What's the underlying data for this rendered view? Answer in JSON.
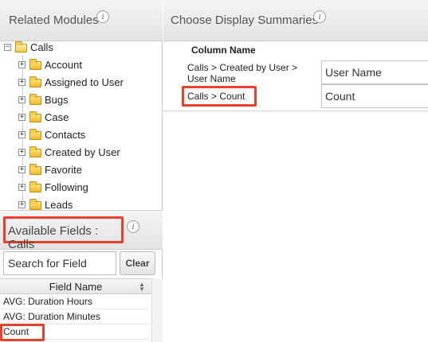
{
  "related_modules": {
    "title": "Related Modules",
    "info": "i",
    "root": "Calls",
    "items": [
      "Account",
      "Assigned to User",
      "Bugs",
      "Case",
      "Contacts",
      "Created by User",
      "Favorite",
      "Following",
      "Leads"
    ]
  },
  "available_fields": {
    "title": "Available Fields : Calls",
    "info": "i",
    "search_placeholder": "Search for Field",
    "clear_label": "Clear",
    "column_header": "Field Name",
    "rows": [
      "AVG: Duration Hours",
      "AVG: Duration Minutes",
      "Count"
    ]
  },
  "display_summaries": {
    "title": "Choose Display Summaries",
    "info": "i",
    "column_header": "Column Name",
    "rows": [
      {
        "label": "Calls > Created by User > User Name",
        "value": "User Name"
      },
      {
        "label": "Calls > Count",
        "value": "Count"
      }
    ]
  },
  "colors": {
    "highlight": "#e8402a",
    "folder": "#f0b92b"
  }
}
